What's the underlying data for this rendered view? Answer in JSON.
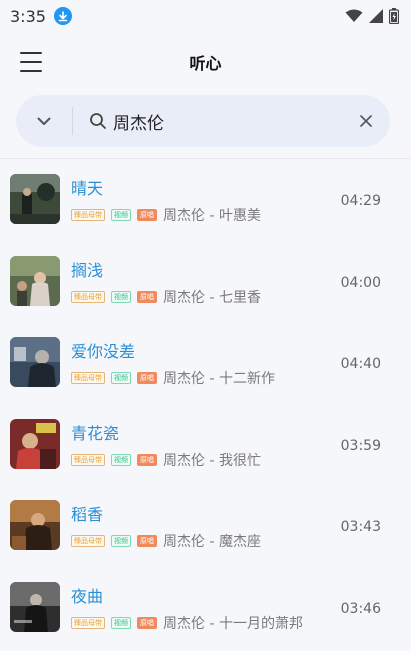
{
  "status": {
    "time": "3:35"
  },
  "header": {
    "title": "听心"
  },
  "search": {
    "query": "周杰伦"
  },
  "tags": {
    "quality": "臻品母带",
    "video": "视频",
    "original": "原唱"
  },
  "songs": [
    {
      "title": "晴天",
      "subtitle": "周杰伦 - 叶惠美",
      "duration": "04:29"
    },
    {
      "title": "搁浅",
      "subtitle": "周杰伦 - 七里香",
      "duration": "04:00"
    },
    {
      "title": "爱你没差",
      "subtitle": "周杰伦 - 十二新作",
      "duration": "04:40"
    },
    {
      "title": "青花瓷",
      "subtitle": "周杰伦 - 我很忙",
      "duration": "03:59"
    },
    {
      "title": "稻香",
      "subtitle": "周杰伦 - 魔杰座",
      "duration": "03:43"
    },
    {
      "title": "夜曲",
      "subtitle": "周杰伦 - 十一月的萧邦",
      "duration": "03:46"
    }
  ],
  "colors": {
    "accent": "#2a8fd6",
    "background": "#f6f7fb",
    "search_bg": "#e9edf7"
  }
}
